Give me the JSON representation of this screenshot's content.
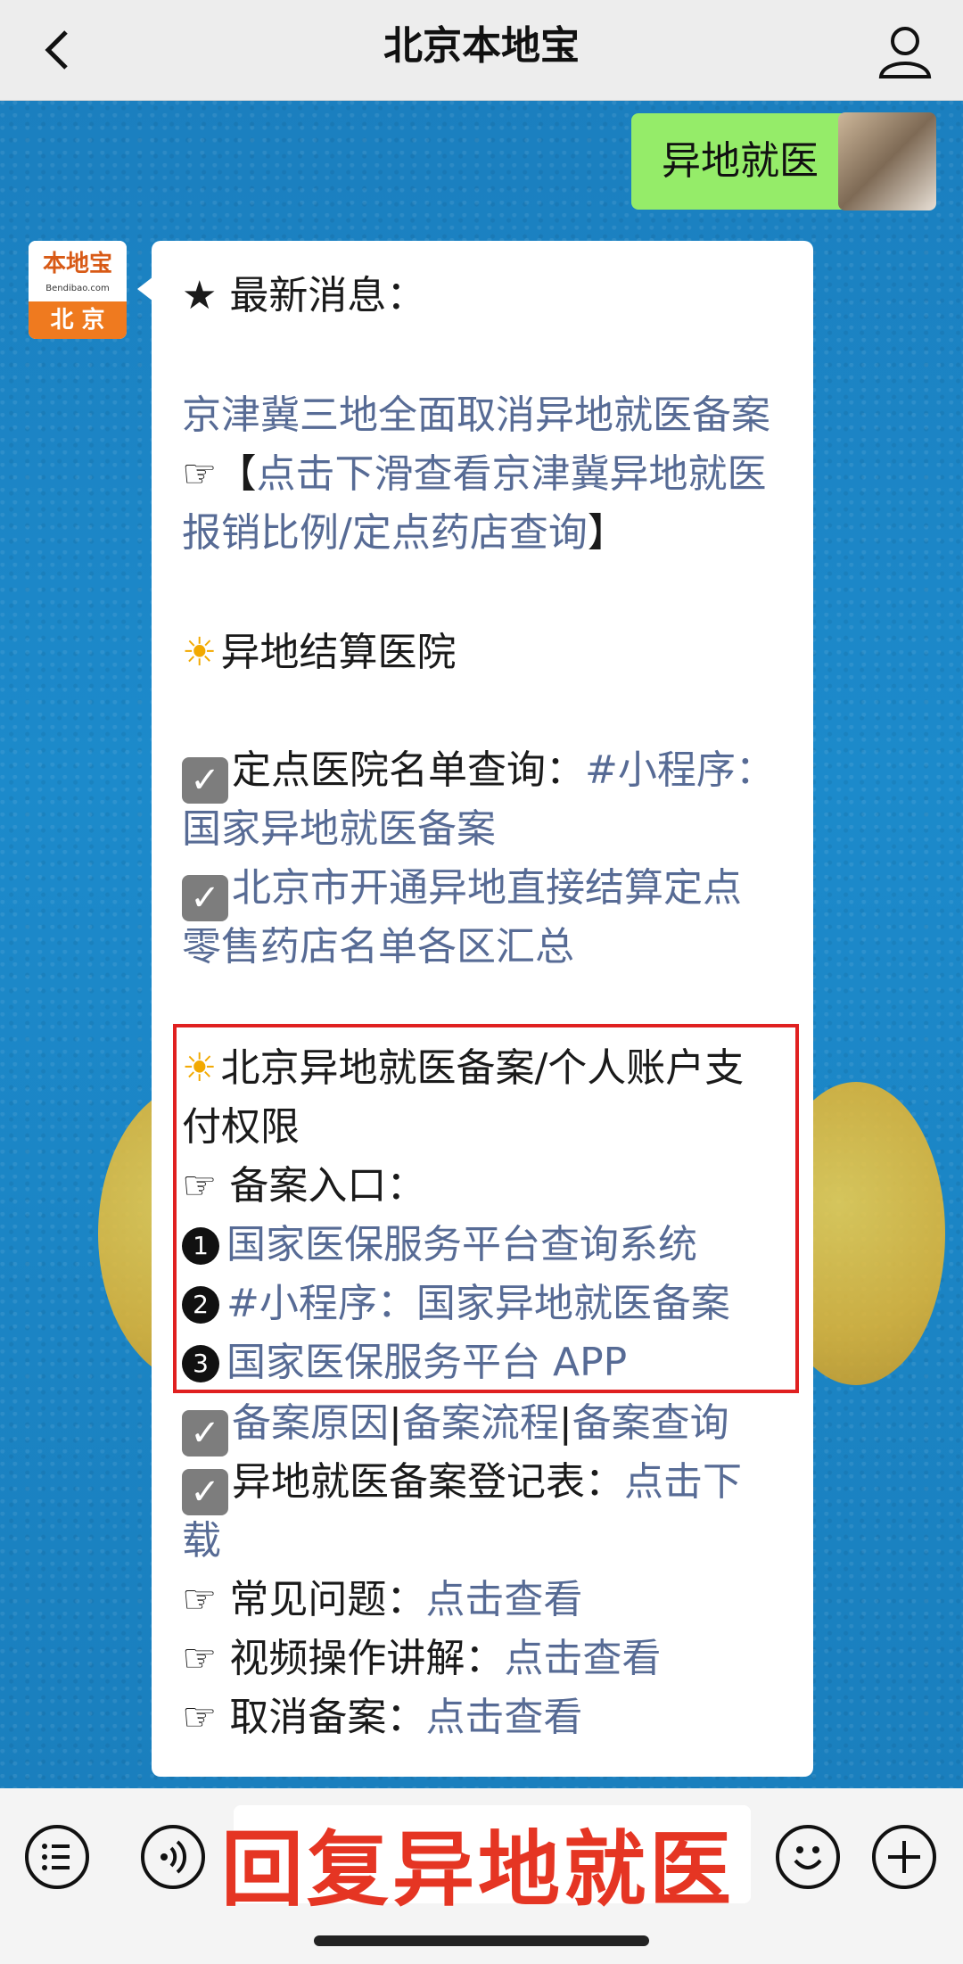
{
  "header": {
    "title": "北京本地宝"
  },
  "icons": [
    "back-icon",
    "user-icon",
    "list-icon",
    "voice-icon",
    "emoji-icon",
    "plus-icon"
  ],
  "my_message": {
    "text": "异地就医"
  },
  "bot_avatar": {
    "top": "本地宝",
    "domain": "Bendibao.com",
    "bottom": "北 京"
  },
  "bot_message": {
    "latest": "★ 最新消息：",
    "link1": "京津冀三地全面取消异地就医备案",
    "hand1": "☞【",
    "link2a": "点击下滑查看京津冀异地就医",
    "link2b": "报销比例/定点药店查询",
    "bracket_close": "】",
    "sec1_title": "异地结算医院",
    "check1_label": "定点医院名单查询：",
    "check1_link_a": "#小程序：",
    "check1_link_b": "国家异地就医备案",
    "check2_link_a": "北京市开通异地直接结算定点",
    "check2_link_b": "零售药店名单各区汇总",
    "sec2_title_a": "北京异地就医备案/个人账户支",
    "sec2_title_b": "付权限",
    "entry_label": "☞ 备案入口：",
    "entry1": "国家医保服务平台查询系统",
    "entry2": "#小程序：国家异地就医备案",
    "entry3": "国家医保服务平台 APP",
    "num1": "1",
    "num2": "2",
    "num3": "3",
    "links_row_a": "备案原因",
    "links_row_b": "备案流程",
    "links_row_c": "备案查询",
    "sep": "|",
    "form_label": "异地就医备案登记表：",
    "form_link_a": "点击下",
    "form_link_b": "载",
    "faq_label": "☞ 常见问题：",
    "faq_link": "点击查看",
    "video_label": "☞ 视频操作讲解：",
    "video_link": "点击查看",
    "cancel_label": "☞ 取消备案：",
    "cancel_link": "点击查看"
  },
  "overlay": {
    "text": "回复异地就医"
  }
}
